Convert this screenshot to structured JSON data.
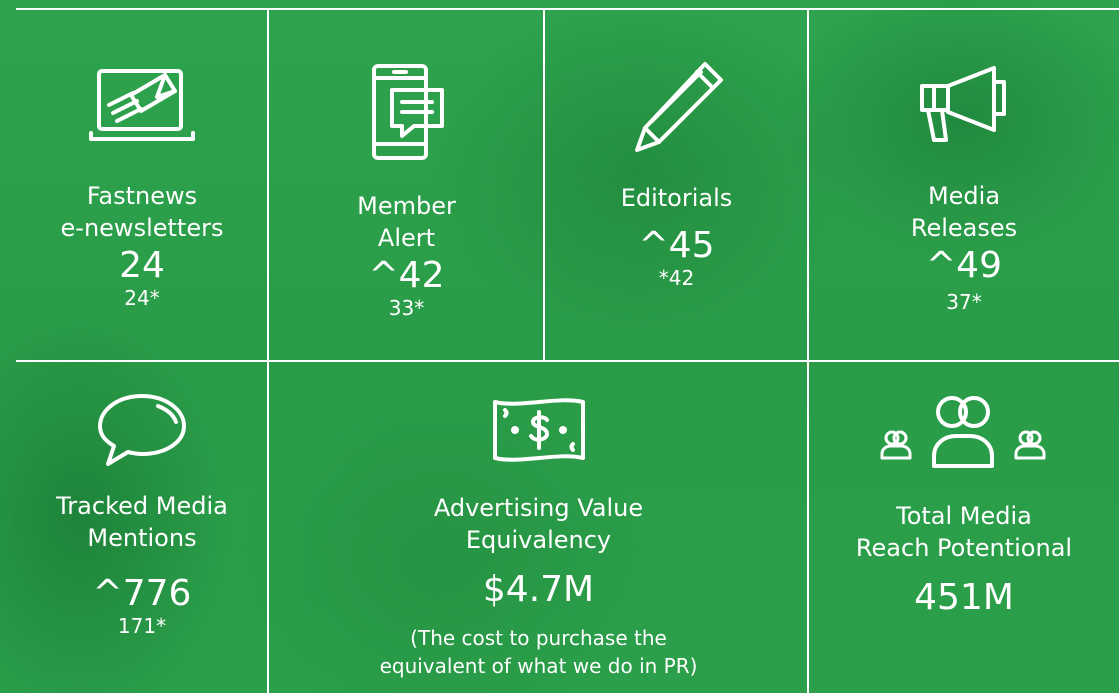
{
  "tiles": [
    {
      "label_line1": "Fastnews",
      "label_line2": "e-newsletters",
      "value": "24",
      "sub": "24*",
      "icon": "envelope-laptop-icon"
    },
    {
      "label_line1": "Member",
      "label_line2": "Alert",
      "value": "^42",
      "sub": "33*",
      "icon": "phone-message-icon"
    },
    {
      "label_line1": "Editorials",
      "value": "^45",
      "sub": "*42",
      "icon": "pencil-icon"
    },
    {
      "label_line1": "Media",
      "label_line2": "Releases",
      "value": "^49",
      "sub": "37*",
      "icon": "megaphone-icon"
    },
    {
      "label_line1": "Tracked Media",
      "label_line2": "Mentions",
      "value": "^776",
      "sub": "171*",
      "icon": "speech-bubble-icon"
    },
    {
      "label_line1": "Advertising Value",
      "label_line2": "Equivalency",
      "value": "$4.7M",
      "note_line1": "(The cost to purchase the",
      "note_line2": "equivalent of what we do in PR)",
      "icon": "dollar-bill-icon"
    },
    {
      "label_line1": "Total Media",
      "label_line2": "Reach Potentional",
      "value": "451M",
      "icon": "audience-icon"
    }
  ],
  "colors": {
    "background": "#2a9c48",
    "foreground": "#ffffff"
  }
}
